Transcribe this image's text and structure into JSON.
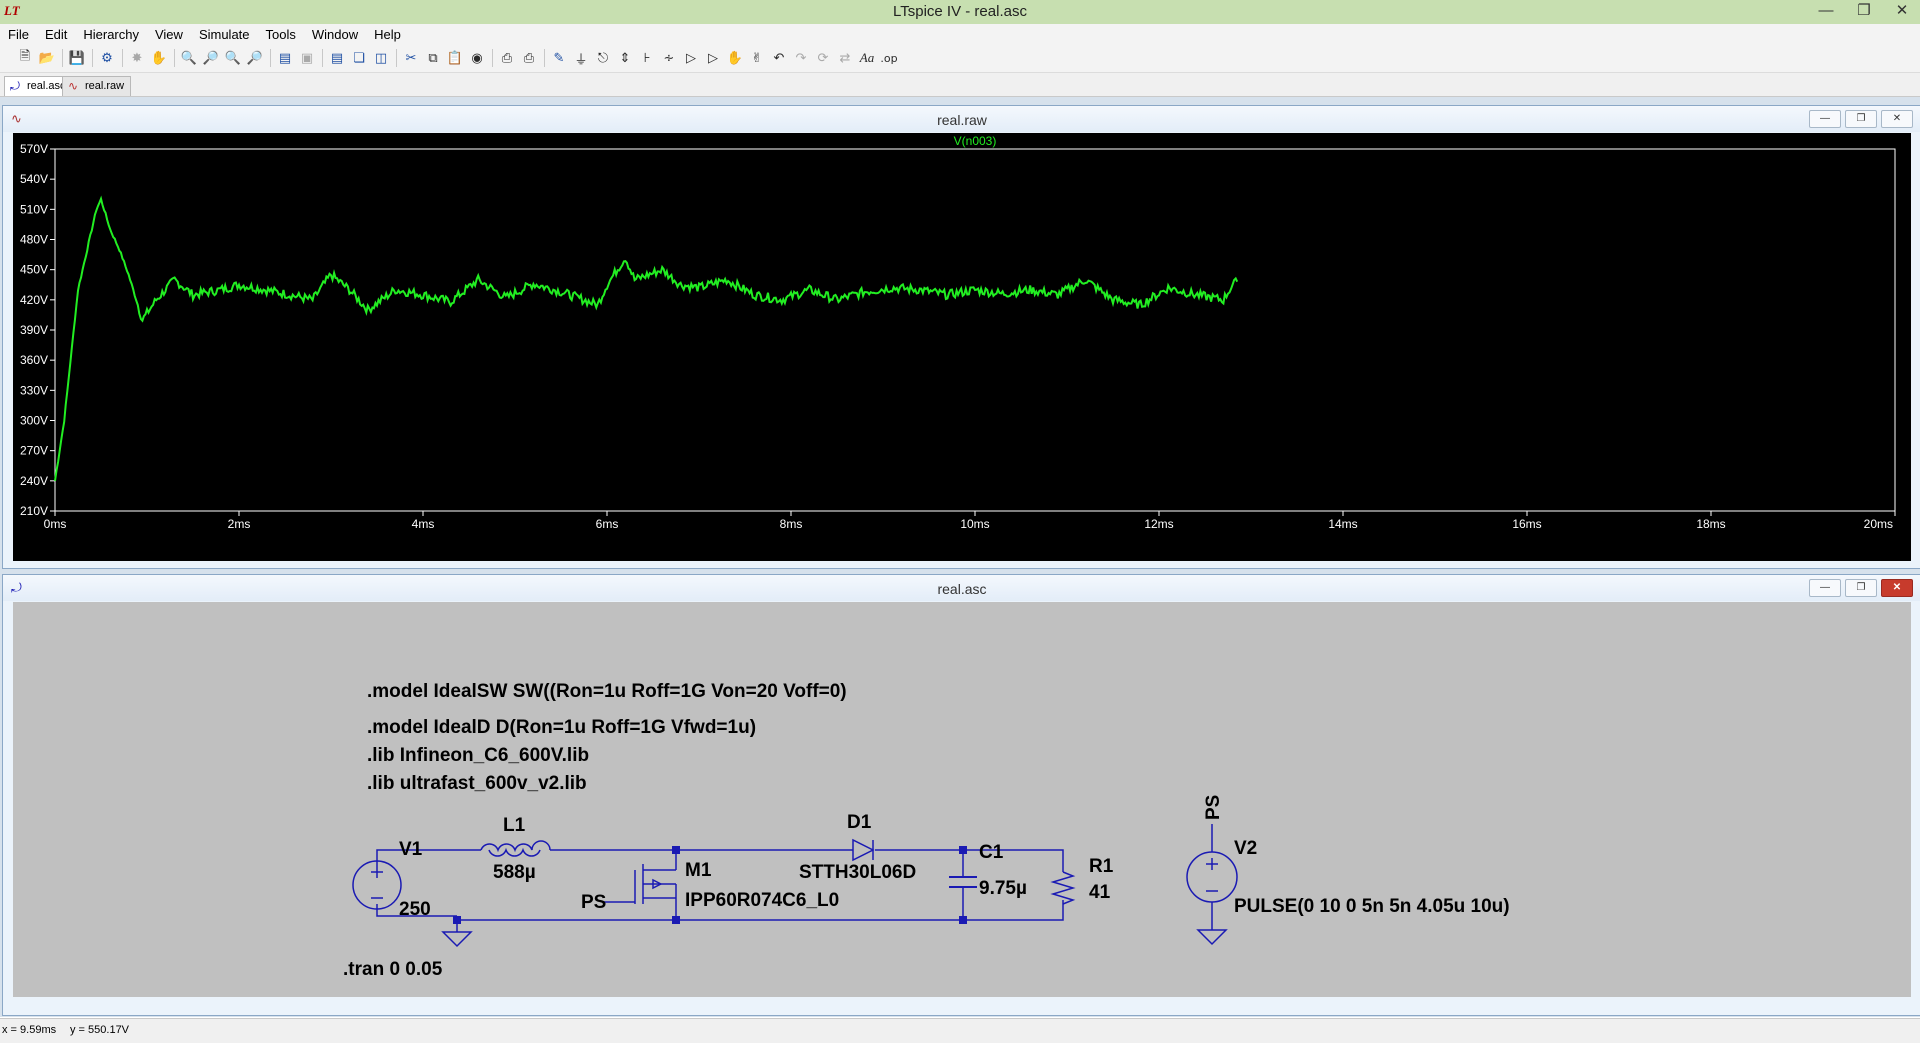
{
  "window": {
    "title": "LTspice IV - real.asc",
    "icon": "ltspice-logo-icon",
    "controls": [
      "minimize",
      "restore",
      "close"
    ]
  },
  "menu": [
    "File",
    "Edit",
    "Hierarchy",
    "View",
    "Simulate",
    "Tools",
    "Window",
    "Help"
  ],
  "toolbar": {
    "buttons": [
      "new-schematic-icon",
      "open-icon",
      "save-icon",
      "control-panel-icon",
      "run-icon",
      "halt-icon",
      "pan-icon",
      "zoom-in-icon",
      "zoom-extents-icon",
      "zoom-out-icon",
      "zoom-fit-icon",
      "autorange-icon",
      "delete-trace-icon",
      "tile-horizontal-icon",
      "cascade-icon",
      "tile-vertical-icon",
      "cut-icon",
      "copy-icon",
      "paste-icon",
      "find-icon",
      "print-icon",
      "print-preview-icon",
      "wire-icon",
      "ground-icon",
      "label-net-icon",
      "resistor-icon",
      "capacitor-icon",
      "inductor-icon",
      "diode-icon",
      "component-icon",
      "move-icon",
      "drag-icon",
      "undo-icon",
      "redo-icon",
      "rotate-icon",
      "mirror-icon",
      "text-icon",
      "spice-directive-icon"
    ]
  },
  "tabs": [
    {
      "label": "real.asc",
      "icon": "schematic-icon",
      "active": true
    },
    {
      "label": "real.raw",
      "icon": "waveform-icon",
      "active": false
    }
  ],
  "waveform_window": {
    "title": "real.raw",
    "icon": "waveform-icon"
  },
  "schematic_window": {
    "title": "real.asc",
    "icon": "schematic-icon"
  },
  "chart_data": {
    "type": "line",
    "title": "",
    "xlabel": "",
    "ylabel": "",
    "xlim": [
      0,
      20
    ],
    "ylim": [
      210,
      570
    ],
    "x_tick_labels": [
      "0ms",
      "2ms",
      "4ms",
      "6ms",
      "8ms",
      "10ms",
      "12ms",
      "14ms",
      "16ms",
      "18ms",
      "20ms"
    ],
    "y_tick_labels": [
      "570V",
      "540V",
      "510V",
      "480V",
      "450V",
      "420V",
      "390V",
      "360V",
      "330V",
      "300V",
      "270V",
      "240V",
      "210V"
    ],
    "grid": false,
    "legend_position": "top-center",
    "background": "#000000",
    "series": [
      {
        "name": "V(n003)",
        "color": "#22ee22",
        "x": [
          0,
          0.1,
          0.25,
          0.45,
          0.5,
          0.6,
          0.7,
          0.8,
          0.95,
          1.1,
          1.3,
          1.5,
          1.8,
          2.0,
          2.4,
          2.8,
          3.0,
          3.2,
          3.4,
          3.7,
          4.0,
          4.3,
          4.6,
          4.9,
          5.2,
          5.5,
          5.9,
          6.0,
          6.2,
          6.3,
          6.6,
          6.8,
          7.0,
          7.3,
          7.6,
          7.9,
          8.2,
          8.5,
          8.8,
          9.1,
          9.4,
          9.7,
          10.0,
          10.3,
          10.6,
          10.9,
          11.2,
          11.5,
          11.8,
          12.1,
          12.4,
          12.7,
          12.8,
          12.85
        ],
        "y": [
          240,
          300,
          430,
          510,
          520,
          490,
          470,
          445,
          400,
          420,
          440,
          425,
          430,
          435,
          428,
          420,
          445,
          430,
          410,
          430,
          425,
          418,
          440,
          422,
          436,
          428,
          415,
          435,
          462,
          440,
          450,
          435,
          432,
          440,
          425,
          420,
          430,
          420,
          428,
          432,
          430,
          425,
          430,
          426,
          430,
          425,
          440,
          420,
          415,
          432,
          425,
          420,
          435,
          438
        ]
      }
    ]
  },
  "schematic": {
    "directives": [
      ".model IdealSW SW((Ron=1u Roff=1G Von=20 Voff=0)",
      ".model IdealD D(Ron=1u Roff=1G Vfwd=1u)",
      ".lib Infineon_C6_600V.lib",
      ".lib ultrafast_600v_v2.lib"
    ],
    "tran": ".tran 0 0.05",
    "components": {
      "V1": {
        "name": "V1",
        "value": "250"
      },
      "L1": {
        "name": "L1",
        "value": "588µ"
      },
      "M1": {
        "name": "M1",
        "value": "IPP60R074C6_L0"
      },
      "D1": {
        "name": "D1",
        "value": "STTH30L06D"
      },
      "C1": {
        "name": "C1",
        "value": "9.75µ"
      },
      "R1": {
        "name": "R1",
        "value": "41"
      },
      "V2": {
        "name": "V2",
        "value": "PULSE(0 10 0 5n 5n 4.05u 10u)"
      }
    },
    "net_labels": {
      "gate": "PS",
      "v2_top": "PS"
    },
    "colors": {
      "wire": "#1a1ab3",
      "symbol": "#1a1ab3",
      "text": "#000000",
      "background": "#c0c0c0"
    }
  },
  "status": {
    "x": "x = 9.59ms",
    "y": "y = 550.17V"
  }
}
